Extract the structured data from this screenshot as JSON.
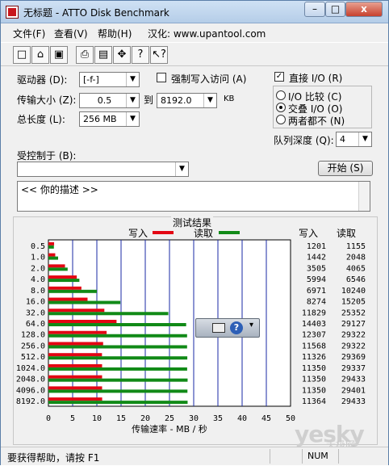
{
  "window": {
    "title": "无标题 - ATTO Disk Benchmark",
    "buttons": {
      "minimize": "–",
      "maximize": "□",
      "close": "x"
    }
  },
  "menu": {
    "file": "文件(F)",
    "view": "查看(V)",
    "help": "帮助(H)",
    "localized": "汉化: www.upantool.com"
  },
  "toolbar": {
    "new": "new-document-icon",
    "open": "open-folder-icon",
    "save": "save-disk-icon",
    "print": "printer-icon",
    "preview": "print-preview-icon",
    "move": "move-arrows-icon",
    "help": "question-mark-icon",
    "context_help": "context-help-icon"
  },
  "settings": {
    "drive_label": "驱动器 (D):",
    "drive_value": "[-f-]",
    "transfer_label": "传输大小 (Z):",
    "transfer_from": "0.5",
    "to_label": "到",
    "transfer_to": "8192.0",
    "kb_unit": "KB",
    "total_length_label": "总长度 (L):",
    "total_length_value": "256 MB",
    "force_write_label": "强制写入访问 (A)",
    "force_write_checked": false,
    "direct_io_label": "直接 I/O (R)",
    "direct_io_checked": true,
    "io_compare_label": "I/O 比较 (C)",
    "overlapped_label": "交叠 I/O (O)",
    "neither_label": "两者都不 (N)",
    "selected_io": "overlapped",
    "queue_depth_label": "队列深度 (Q):",
    "queue_depth_value": "4",
    "controlled_by_label": "受控制于 (B):",
    "controlled_by_value": "",
    "start_button": "开始 (S)",
    "description_text": "<<  你的描述   >>"
  },
  "results": {
    "group_title": "测试结果",
    "legend_write": "写入",
    "legend_read": "读取",
    "col_write": "写入",
    "col_read": "读取",
    "write_color": "#e30613",
    "read_color": "#118a17"
  },
  "chart_data": {
    "type": "bar",
    "title": "测试结果",
    "xlabel": "传输速率 - MB / 秒",
    "ylabel": "",
    "xlim": [
      0,
      50
    ],
    "xticks": [
      "0",
      "5",
      "10",
      "15",
      "20",
      "25",
      "30",
      "35",
      "40",
      "45",
      "50"
    ],
    "categories": [
      "0.5",
      "1.0",
      "2.0",
      "4.0",
      "8.0",
      "16.0",
      "32.0",
      "64.0",
      "128.0",
      "256.0",
      "512.0",
      "1024.0",
      "2048.0",
      "4096.0",
      "8192.0"
    ],
    "series": [
      {
        "name": "写入",
        "values": [
          1201,
          1442,
          3505,
          5994,
          6971,
          8274,
          11829,
          14403,
          12307,
          11568,
          11326,
          11350,
          11350,
          11350,
          11364
        ]
      },
      {
        "name": "读取",
        "values": [
          1155,
          2048,
          4065,
          6546,
          10240,
          15205,
          25352,
          29127,
          29322,
          29322,
          29369,
          29337,
          29433,
          29401,
          29433
        ]
      }
    ],
    "grid": true,
    "legend_position": "top"
  },
  "popup": {
    "keyboard_icon": "keyboard-icon",
    "help_icon": "help-circle-icon",
    "more_icon": "more-icon"
  },
  "status": {
    "message": "要获得帮助，请按 F1",
    "num": "NUM"
  },
  "watermark": {
    "brand": "yesky",
    "sub": "天极网"
  }
}
